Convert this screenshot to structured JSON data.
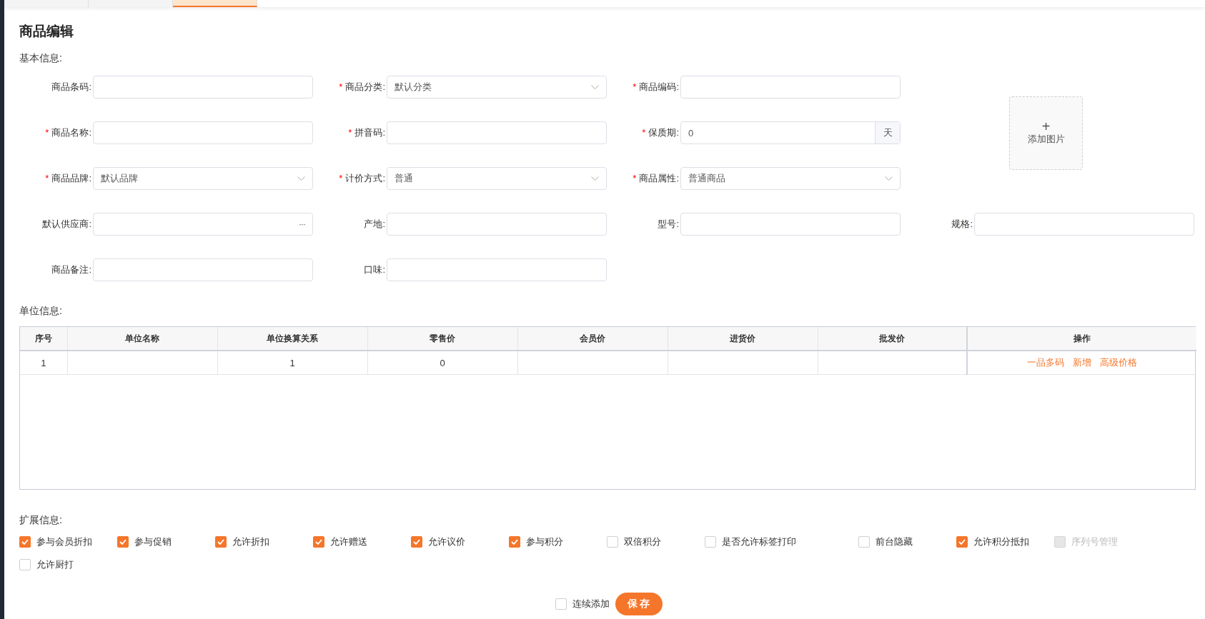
{
  "tabs": [
    {
      "selected": false
    },
    {
      "selected": false
    },
    {
      "selected": true
    }
  ],
  "page_title": "商品编辑",
  "basic_info": {
    "heading": "基本信息:",
    "rows": [
      [
        {
          "kind": "text",
          "label": "商品条码:"
        },
        {
          "kind": "select",
          "label": "商品分类:",
          "required_mark": "*",
          "value": "默认分类"
        },
        {
          "kind": "text",
          "label": "商品编码:",
          "required_mark": "*"
        }
      ],
      [
        {
          "kind": "text",
          "label": "商品名称:",
          "required_mark": "*"
        },
        {
          "kind": "text",
          "label": "拼音码:",
          "required_mark": "*"
        },
        {
          "kind": "unit",
          "label": "保质期:",
          "required_mark": "*",
          "value": "0",
          "unit": "天"
        }
      ],
      [
        {
          "kind": "select",
          "label": "商品品牌:",
          "required_mark": "*",
          "value": "默认品牌"
        },
        {
          "kind": "select",
          "label": "计价方式:",
          "required_mark": "*",
          "value": "普通"
        },
        {
          "kind": "select",
          "label": "商品属性:",
          "required_mark": "*",
          "value": "普通商品"
        }
      ],
      [
        {
          "kind": "picker",
          "label": "默认供应商:",
          "button": "···"
        },
        {
          "kind": "text",
          "label": "产地:"
        },
        {
          "kind": "text",
          "label": "型号:"
        },
        {
          "kind": "text",
          "label": "规格:"
        }
      ],
      [
        {
          "kind": "text",
          "label": "商品备注:"
        },
        {
          "kind": "text",
          "label": "口味:"
        }
      ]
    ],
    "image_upload": {
      "icon": "+",
      "label": "添加图片"
    }
  },
  "unit_info": {
    "heading": "单位信息:",
    "table": {
      "columns": [
        "序号",
        "单位名称",
        "单位换算关系",
        "零售价",
        "会员价",
        "进货价",
        "批发价",
        "操作"
      ],
      "rows": [
        {
          "cells": [
            "1",
            "",
            "1",
            "0",
            "",
            "",
            ""
          ],
          "actions": [
            "一品多码",
            "新增",
            "高级价格"
          ]
        }
      ]
    }
  },
  "ext_info": {
    "heading": "扩展信息:",
    "options": [
      {
        "label": "参与会员折扣",
        "checked": true,
        "disabled": false
      },
      {
        "label": "参与促销",
        "checked": true,
        "disabled": false
      },
      {
        "label": "允许折扣",
        "checked": true,
        "disabled": false
      },
      {
        "label": "允许赠送",
        "checked": true,
        "disabled": false
      },
      {
        "label": "允许议价",
        "checked": true,
        "disabled": false
      },
      {
        "label": "参与积分",
        "checked": true,
        "disabled": false
      },
      {
        "label": "双倍积分",
        "checked": false,
        "disabled": false
      },
      {
        "label": "是否允许标签打印",
        "checked": false,
        "disabled": false
      },
      {
        "label": "前台隐藏",
        "checked": false,
        "disabled": false
      },
      {
        "label": "允许积分抵扣",
        "checked": true,
        "disabled": false
      },
      {
        "label": "序列号管理",
        "checked": false,
        "disabled": true
      },
      {
        "label": "允许厨打",
        "checked": false,
        "disabled": false
      }
    ]
  },
  "footer": {
    "continuous_add": {
      "label": "连续添加",
      "checked": false
    },
    "save_button": "保 存"
  }
}
